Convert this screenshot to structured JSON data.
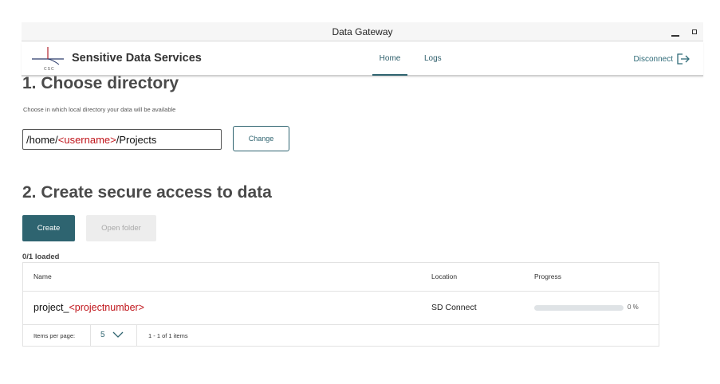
{
  "window": {
    "title": "Data Gateway"
  },
  "header": {
    "logo_text": "CSC",
    "brand": "Sensitive Data Services",
    "nav": {
      "home": "Home",
      "logs": "Logs"
    },
    "disconnect_label": "Disconnect"
  },
  "section1": {
    "heading": "1. Choose directory",
    "subtitle": "Choose in which local directory your data will be available",
    "path_prefix": "/home/",
    "path_placeholder": "<username>",
    "path_suffix": "/Projects",
    "change_label": "Change"
  },
  "section2": {
    "heading": "2. Create secure access to data",
    "create_label": "Create",
    "open_folder_label": "Open folder",
    "loaded_status": "0/1 loaded"
  },
  "table": {
    "columns": {
      "name": "Name",
      "location": "Location",
      "progress": "Progress"
    },
    "rows": [
      {
        "name_prefix": "project_",
        "name_placeholder": "<projectnumber>",
        "location": "SD Connect",
        "progress_fraction": 0,
        "progress_text": "0 %"
      }
    ],
    "footer": {
      "items_per_page_label": "Items per page:",
      "page_size": "5",
      "range_text": "1 - 1 of 1 items"
    }
  },
  "colors": {
    "accent": "#2e6470",
    "placeholder_red": "#c0151b",
    "disabled_bg": "#ededed"
  }
}
